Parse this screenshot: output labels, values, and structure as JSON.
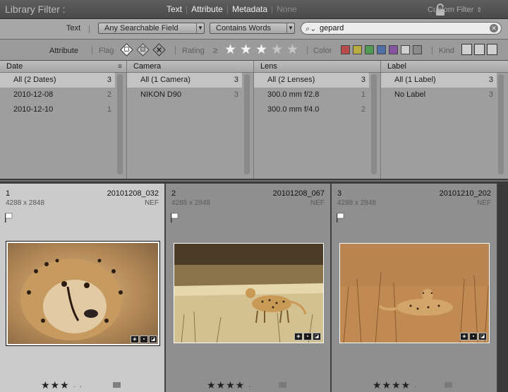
{
  "topbar": {
    "title": "Library Filter :",
    "tabs": [
      "Text",
      "Attribute",
      "Metadata",
      "None"
    ],
    "preset": "Custom Filter"
  },
  "text_row": {
    "label": "Text",
    "field": "Any Searchable Field",
    "rule": "Contains Words",
    "query": "gepard"
  },
  "attribute_row": {
    "label": "Attribute",
    "flag_label": "Flag",
    "rating_label": "Rating",
    "rating_op": "≥",
    "rating_stars": 3,
    "color_label": "Color",
    "kind_label": "Kind",
    "colors": [
      "#b84b4b",
      "#b8ad43",
      "#4f9a55",
      "#4f6fa8",
      "#8653a0",
      "#cfcfcf",
      "#8a8a8a"
    ]
  },
  "metadata": {
    "columns": [
      {
        "header": "Date",
        "rows": [
          {
            "label": "All (2 Dates)",
            "count": "3"
          },
          {
            "label": "2010-12-08",
            "count": "2"
          },
          {
            "label": "2010-12-10",
            "count": "1"
          }
        ]
      },
      {
        "header": "Camera",
        "rows": [
          {
            "label": "All (1 Camera)",
            "count": "3"
          },
          {
            "label": "NIKON D90",
            "count": "3"
          }
        ]
      },
      {
        "header": "Lens",
        "rows": [
          {
            "label": "All (2 Lenses)",
            "count": "3"
          },
          {
            "label": "300.0 mm f/2.8",
            "count": "1"
          },
          {
            "label": "300.0 mm f/4.0",
            "count": "2"
          }
        ]
      },
      {
        "header": "Label",
        "rows": [
          {
            "label": "All (1 Label)",
            "count": "3"
          },
          {
            "label": "No Label",
            "count": "3"
          }
        ]
      }
    ]
  },
  "photos": [
    {
      "index": "1",
      "filename": "20101208_032",
      "dims": "4288 x 2848",
      "ext": "NEF",
      "stars": "★★★",
      "selected": true
    },
    {
      "index": "2",
      "filename": "20101208_067",
      "dims": "4288 x 2848",
      "ext": "NEF",
      "stars": "★★★★",
      "selected": false
    },
    {
      "index": "3",
      "filename": "20101210_202",
      "dims": "4288 x 2848",
      "ext": "NEF",
      "stars": "★★★★",
      "selected": false
    }
  ]
}
